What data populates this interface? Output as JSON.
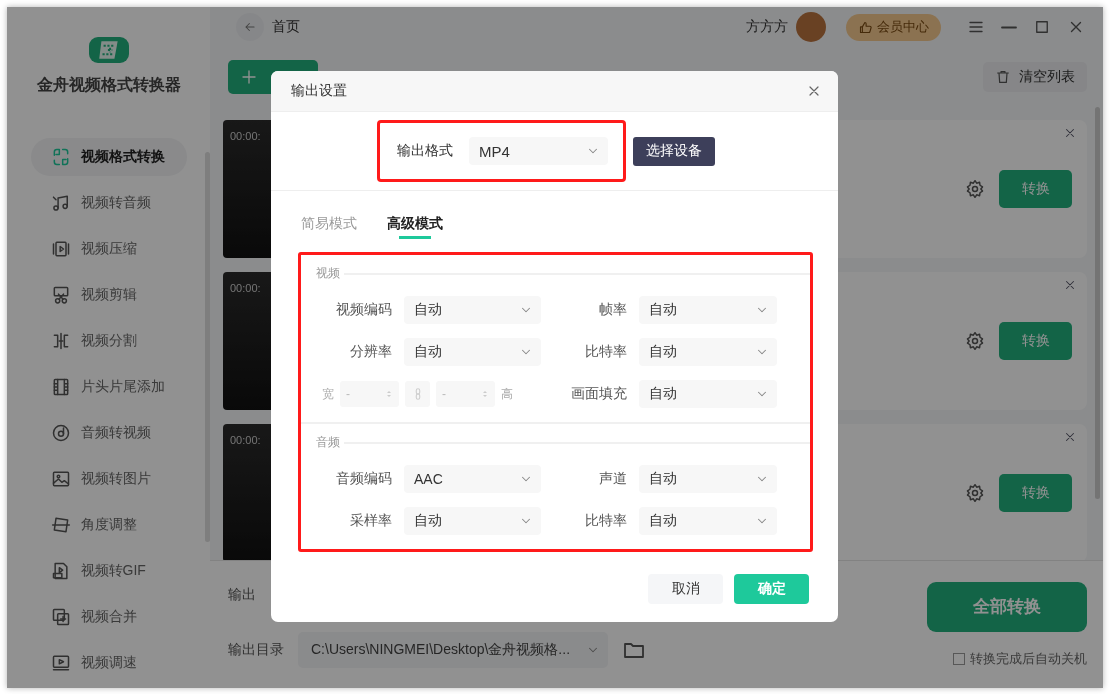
{
  "app": {
    "name": "金舟视频格式转换器"
  },
  "sidebar": {
    "items": [
      {
        "label": "视频格式转换",
        "selected": true
      },
      {
        "label": "视频转音频",
        "selected": false
      },
      {
        "label": "视频压缩",
        "selected": false
      },
      {
        "label": "视频剪辑",
        "selected": false
      },
      {
        "label": "视频分割",
        "selected": false
      },
      {
        "label": "片头片尾添加",
        "selected": false
      },
      {
        "label": "音频转视频",
        "selected": false
      },
      {
        "label": "视频转图片",
        "selected": false
      },
      {
        "label": "角度调整",
        "selected": false
      },
      {
        "label": "视频转GIF",
        "selected": false
      },
      {
        "label": "视频合并",
        "selected": false
      },
      {
        "label": "视频调速",
        "selected": false
      }
    ]
  },
  "topbar": {
    "breadcrumb": "首页",
    "user": "方方方",
    "vip_button": "会员中心"
  },
  "toolbar": {
    "clear_button": "清空列表"
  },
  "files": [
    {
      "duration": "00:00:",
      "convert_button": "转换"
    },
    {
      "duration": "00:00:",
      "convert_button": "转换"
    },
    {
      "duration": "00:00:",
      "convert_button": "转换"
    }
  ],
  "output": {
    "info_label": "输出",
    "dir_label": "输出目录",
    "dir_value": "C:\\Users\\NINGMEI\\Desktop\\金舟视频格...",
    "convert_all": "全部转换",
    "shutdown": {
      "label": "转换完成后自动关机",
      "checked": false
    }
  },
  "dialog": {
    "title": "输出设置",
    "format": {
      "label": "输出格式",
      "value": "MP4",
      "highlighted": true
    },
    "device_button": "选择设备",
    "tabs": [
      {
        "label": "简易模式",
        "selected": false
      },
      {
        "label": "高级模式",
        "selected": true
      }
    ],
    "settings_highlighted": true,
    "sections": [
      {
        "title": "视频",
        "fields": [
          {
            "kind": "select",
            "label": "视频编码",
            "value": "自动"
          },
          {
            "kind": "select",
            "label": "帧率",
            "value": "自动"
          },
          {
            "kind": "select",
            "label": "分辨率",
            "value": "自动"
          },
          {
            "kind": "select",
            "label": "比特率",
            "value": "自动"
          },
          {
            "kind": "size",
            "width_label": "宽",
            "width_value": "-",
            "height_value": "-",
            "height_label": "高",
            "disabled": true
          },
          {
            "kind": "select",
            "label": "画面填充",
            "value": "自动"
          }
        ]
      },
      {
        "title": "音频",
        "fields": [
          {
            "kind": "select",
            "label": "音频编码",
            "value": "AAC"
          },
          {
            "kind": "select",
            "label": "声道",
            "value": "自动"
          },
          {
            "kind": "select",
            "label": "采样率",
            "value": "自动"
          },
          {
            "kind": "select",
            "label": "比特率",
            "value": "自动"
          }
        ]
      }
    ],
    "buttons": [
      {
        "label": "取消",
        "kind": "secondary"
      },
      {
        "label": "确定",
        "kind": "primary"
      }
    ]
  }
}
